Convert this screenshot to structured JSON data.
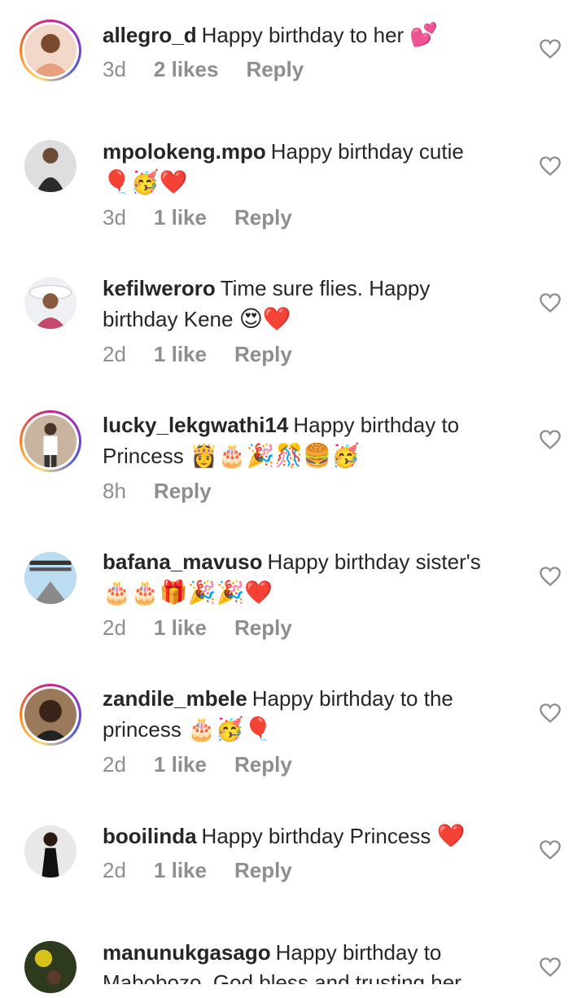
{
  "comments": [
    {
      "username": "allegro_d",
      "text": "Happy birthday to her",
      "emoji": "💕",
      "time": "3d",
      "likes": "2 likes",
      "reply": "Reply"
    },
    {
      "username": "mpolokeng.mpo",
      "text": "Happy birthday cutie",
      "emoji": "🎈🥳❤️",
      "time": "3d",
      "likes": "1 like",
      "reply": "Reply"
    },
    {
      "username": "kefilweroro",
      "text": "Time sure flies. Happy birthday Kene",
      "emoji": "😍❤️",
      "time": "2d",
      "likes": "1 like",
      "reply": "Reply"
    },
    {
      "username": "lucky_lekgwathi14",
      "text": "Happy birthday to Princess",
      "emoji": "👸🎂🎉🎊🍔🥳",
      "time": "8h",
      "likes": "",
      "reply": "Reply"
    },
    {
      "username": "bafana_mavuso",
      "text": "Happy birthday sister's",
      "emoji": "🎂🎂🎁🎉🎉❤️",
      "time": "2d",
      "likes": "1 like",
      "reply": "Reply"
    },
    {
      "username": "zandile_mbele",
      "text": "Happy birthday to the princess",
      "emoji": "🎂🥳🎈",
      "time": "2d",
      "likes": "1 like",
      "reply": "Reply"
    },
    {
      "username": "booilinda",
      "text": "Happy birthday Princess",
      "emoji": "❤️",
      "time": "2d",
      "likes": "1 like",
      "reply": "Reply"
    },
    {
      "username": "manunukgasago",
      "text": "Happy birthday to Mabobozo. God bless and trusting her",
      "emoji": "",
      "time": "",
      "likes": "",
      "reply": ""
    }
  ],
  "icons": {
    "like": "heart-outline-icon"
  },
  "colors": {
    "text": "#262626",
    "meta": "#8e8e8e",
    "heart": "#8e8e8e"
  }
}
